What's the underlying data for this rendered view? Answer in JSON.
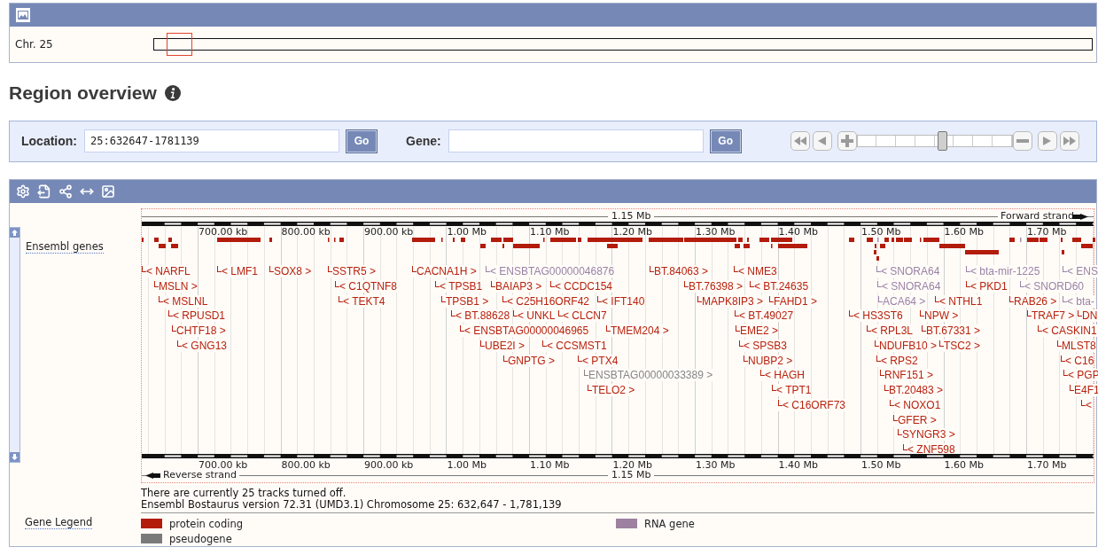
{
  "chromosome_panel": {
    "label": "Chr. 25"
  },
  "heading": "Region overview",
  "search_bar": {
    "location_label": "Location:",
    "location_value": "25:632647-1781139",
    "location_button": "Go",
    "gene_label": "Gene:",
    "gene_button": "Go",
    "zoom": {
      "level": 0.55
    }
  },
  "browser": {
    "track_label": "Ensembl genes",
    "scale_span_top": "1.15 Mb",
    "forward_strand": "Forward strand",
    "top_ticks": [
      "700.00 kb",
      "800.00 kb",
      "900.00 kb",
      "1.00 Mb",
      "1.10 Mb",
      "1.20 Mb",
      "1.30 Mb",
      "1.40 Mb",
      "1.50 Mb",
      "1.60 Mb",
      "1.70 Mb"
    ],
    "gene_rows": [
      [
        {
          "label": "< NARFL",
          "kind": "protein_coding"
        },
        {
          "label": "< LMF1",
          "kind": "protein_coding"
        },
        {
          "label": "SOX8 >",
          "kind": "protein_coding"
        },
        {
          "label": "SSTR5 >",
          "kind": "protein_coding"
        },
        {
          "label": "CACNA1H >",
          "kind": "protein_coding"
        },
        {
          "label": "< ENSBTAG00000046876",
          "kind": "rna"
        },
        {
          "label": "BT.84063 >",
          "kind": "protein_coding"
        },
        {
          "label": "< NME3",
          "kind": "protein_coding"
        },
        {
          "label": "< SNORA64",
          "kind": "rna"
        },
        {
          "label": "< bta-mir-1225",
          "kind": "rna"
        },
        {
          "label": "< ENS",
          "kind": "rna"
        }
      ],
      [
        {
          "label": "MSLN >",
          "kind": "protein_coding"
        },
        {
          "label": "< C1QTNF8",
          "kind": "protein_coding"
        },
        {
          "label": "< TPSB1",
          "kind": "protein_coding"
        },
        {
          "label": "BAIAP3 >",
          "kind": "protein_coding"
        },
        {
          "label": "< CCDC154",
          "kind": "protein_coding"
        },
        {
          "label": "BT.76398 >",
          "kind": "protein_coding"
        },
        {
          "label": "< BT.24635",
          "kind": "protein_coding"
        },
        {
          "label": "< SNORA64",
          "kind": "rna"
        },
        {
          "label": "< PKD1",
          "kind": "protein_coding"
        },
        {
          "label": "< SNORD60",
          "kind": "rna"
        }
      ],
      [
        {
          "label": "< MSLNL",
          "kind": "protein_coding"
        },
        {
          "label": "< TEKT4",
          "kind": "protein_coding"
        },
        {
          "label": "TPSB1 >",
          "kind": "protein_coding"
        },
        {
          "label": "< C25H16ORF42",
          "kind": "protein_coding"
        },
        {
          "label": "< IFT140",
          "kind": "protein_coding"
        },
        {
          "label": "MAPK8IP3 >",
          "kind": "protein_coding"
        },
        {
          "label": "FAHD1 >",
          "kind": "protein_coding"
        },
        {
          "label": "ACA64 >",
          "kind": "rna"
        },
        {
          "label": "< NTHL1",
          "kind": "protein_coding"
        },
        {
          "label": "RAB26 >",
          "kind": "protein_coding"
        },
        {
          "label": "< bta-",
          "kind": "rna"
        }
      ],
      [
        {
          "label": "< RPUSD1",
          "kind": "protein_coding"
        },
        {
          "label": "< BT.88628",
          "kind": "protein_coding"
        },
        {
          "label": "< UNKL",
          "kind": "protein_coding"
        },
        {
          "label": "< CLCN7",
          "kind": "protein_coding"
        },
        {
          "label": "< BT.49027",
          "kind": "protein_coding"
        },
        {
          "label": "< HS3ST6",
          "kind": "protein_coding"
        },
        {
          "label": "NPW >",
          "kind": "protein_coding"
        },
        {
          "label": "TRAF7 >",
          "kind": "protein_coding"
        },
        {
          "label": "DN",
          "kind": "protein_coding"
        }
      ],
      [
        {
          "label": "CHTF18 >",
          "kind": "protein_coding"
        },
        {
          "label": "< ENSBTAG00000046965",
          "kind": "protein_coding"
        },
        {
          "label": "TMEM204 >",
          "kind": "protein_coding"
        },
        {
          "label": "EME2 >",
          "kind": "protein_coding"
        },
        {
          "label": "< RPL3L",
          "kind": "protein_coding"
        },
        {
          "label": "BT.67331 >",
          "kind": "protein_coding"
        },
        {
          "label": "< CASKIN1",
          "kind": "protein_coding"
        }
      ],
      [
        {
          "label": "< GNG13",
          "kind": "protein_coding"
        },
        {
          "label": "UBE2I >",
          "kind": "protein_coding"
        },
        {
          "label": "< CCSMST1",
          "kind": "protein_coding"
        },
        {
          "label": "< SPSB3",
          "kind": "protein_coding"
        },
        {
          "label": "NDUFB10 >",
          "kind": "protein_coding"
        },
        {
          "label": "TSC2 >",
          "kind": "protein_coding"
        },
        {
          "label": "MLST8",
          "kind": "protein_coding"
        }
      ],
      [
        {
          "label": "GNPTG >",
          "kind": "protein_coding"
        },
        {
          "label": "< PTX4",
          "kind": "protein_coding"
        },
        {
          "label": "NUBP2 >",
          "kind": "protein_coding"
        },
        {
          "label": "< RPS2",
          "kind": "protein_coding"
        },
        {
          "label": "< C16",
          "kind": "protein_coding"
        }
      ],
      [
        {
          "label": "ENSBTAG00000033389 >",
          "kind": "pseudogene"
        },
        {
          "label": "< HAGH",
          "kind": "protein_coding"
        },
        {
          "label": "RNF151 >",
          "kind": "protein_coding"
        },
        {
          "label": "< PGP",
          "kind": "protein_coding"
        }
      ],
      [
        {
          "label": "TELO2 >",
          "kind": "protein_coding"
        },
        {
          "label": "< TPT1",
          "kind": "protein_coding"
        },
        {
          "label": "BT.20483 >",
          "kind": "protein_coding"
        },
        {
          "label": "E4F1",
          "kind": "protein_coding"
        }
      ],
      [
        {
          "label": "< C16ORF73",
          "kind": "protein_coding"
        },
        {
          "label": "< NOXO1",
          "kind": "protein_coding"
        },
        {
          "label": "<",
          "kind": "protein_coding"
        }
      ],
      [
        {
          "label": "GFER >",
          "kind": "protein_coding"
        }
      ],
      [
        {
          "label": "SYNGR3 >",
          "kind": "protein_coding"
        }
      ],
      [
        {
          "label": "< ZNF598",
          "kind": "protein_coding"
        }
      ]
    ],
    "bottom_ticks": [
      "700.00 kb",
      "800.00 kb",
      "900.00 kb",
      "1.00 Mb",
      "1.10 Mb",
      "1.20 Mb",
      "1.30 Mb",
      "1.40 Mb",
      "1.50 Mb",
      "1.60 Mb",
      "1.70 Mb"
    ],
    "reverse_strand": "Reverse strand",
    "scale_span_bottom": "1.15 Mb",
    "notes": [
      "There are currently 25 tracks turned off.",
      "Ensembl Bostaurus version 72.31 (UMD3.1) Chromosome 25: 632,647 - 1,781,139"
    ],
    "legend": {
      "title": "Gene Legend",
      "items": [
        {
          "label": "protein coding",
          "color": "#b31b0b"
        },
        {
          "label": "pseudogene",
          "color": "#7a7a7a"
        },
        {
          "label": "RNA gene",
          "color": "#9e80a0"
        }
      ]
    }
  }
}
